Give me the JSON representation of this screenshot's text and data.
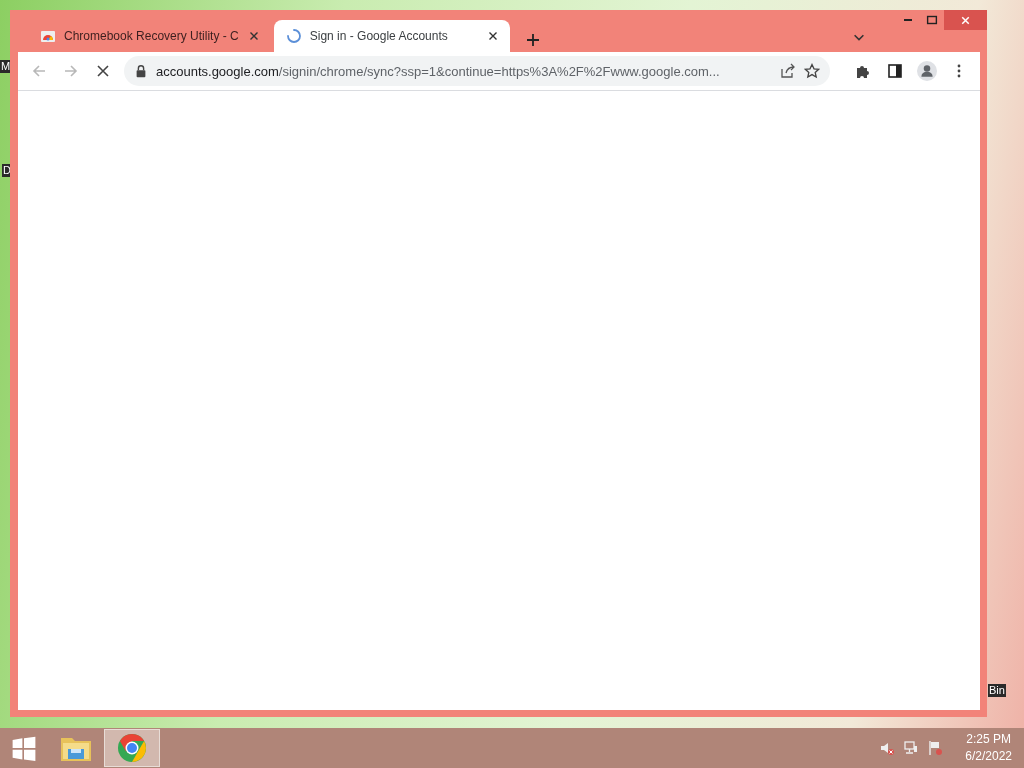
{
  "desktop_labels": [
    "M",
    "D",
    "Bin"
  ],
  "window": {
    "tabs": [
      {
        "title": "Chromebook Recovery Utility - C",
        "selected": false,
        "loading": false
      },
      {
        "title": "Sign in - Google Accounts",
        "selected": true,
        "loading": true
      }
    ],
    "address_bar": {
      "host": "accounts.google.com",
      "path": "/signin/chrome/sync?ssp=1&continue=https%3A%2F%2Fwww.google.com..."
    },
    "page_loading": true
  },
  "taskbar": {
    "apps": [
      {
        "kind": "explorer",
        "selected": false
      },
      {
        "kind": "chrome",
        "selected": true
      }
    ],
    "clock": {
      "time": "2:25 PM",
      "date": "6/2/2022"
    }
  }
}
